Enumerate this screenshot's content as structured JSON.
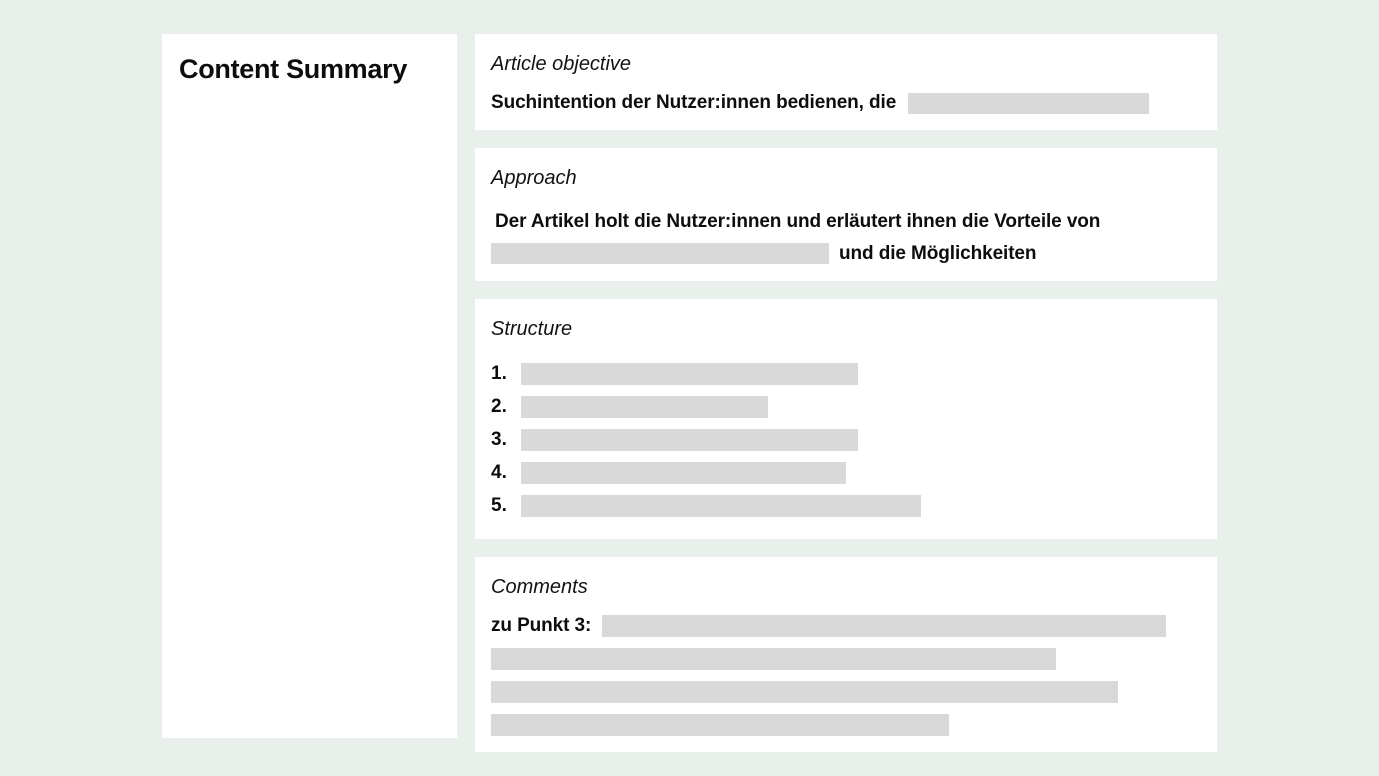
{
  "background_color": "#e9efea",
  "card_color": "#ffffff",
  "redaction_color": "#d9d9d9",
  "left_panel": {
    "title": "Content Summary"
  },
  "cards": {
    "objective": {
      "heading": "Article objective",
      "text": "Suchintention der Nutzer:innen bedienen, die",
      "redaction_width": 241
    },
    "approach": {
      "heading": "Approach",
      "line_1": "Der Artikel holt die Nutzer:innen und erläutert ihnen die Vorteile von",
      "line_2_redaction_width": 338,
      "line_2_text": "und die Möglichkeiten"
    },
    "structure": {
      "heading": "Structure",
      "items": [
        {
          "number": "1.",
          "redaction_width": 337
        },
        {
          "number": "2.",
          "redaction_width": 247
        },
        {
          "number": "3.",
          "redaction_width": 337
        },
        {
          "number": "4.",
          "redaction_width": 325
        },
        {
          "number": "5.",
          "redaction_width": 400
        }
      ]
    },
    "comments": {
      "heading": "Comments",
      "label": "zu Punkt 3:",
      "first_redaction_width": 564,
      "rows": [
        {
          "redaction_width": 565
        },
        {
          "redaction_width": 627
        },
        {
          "redaction_width": 458
        }
      ]
    }
  }
}
